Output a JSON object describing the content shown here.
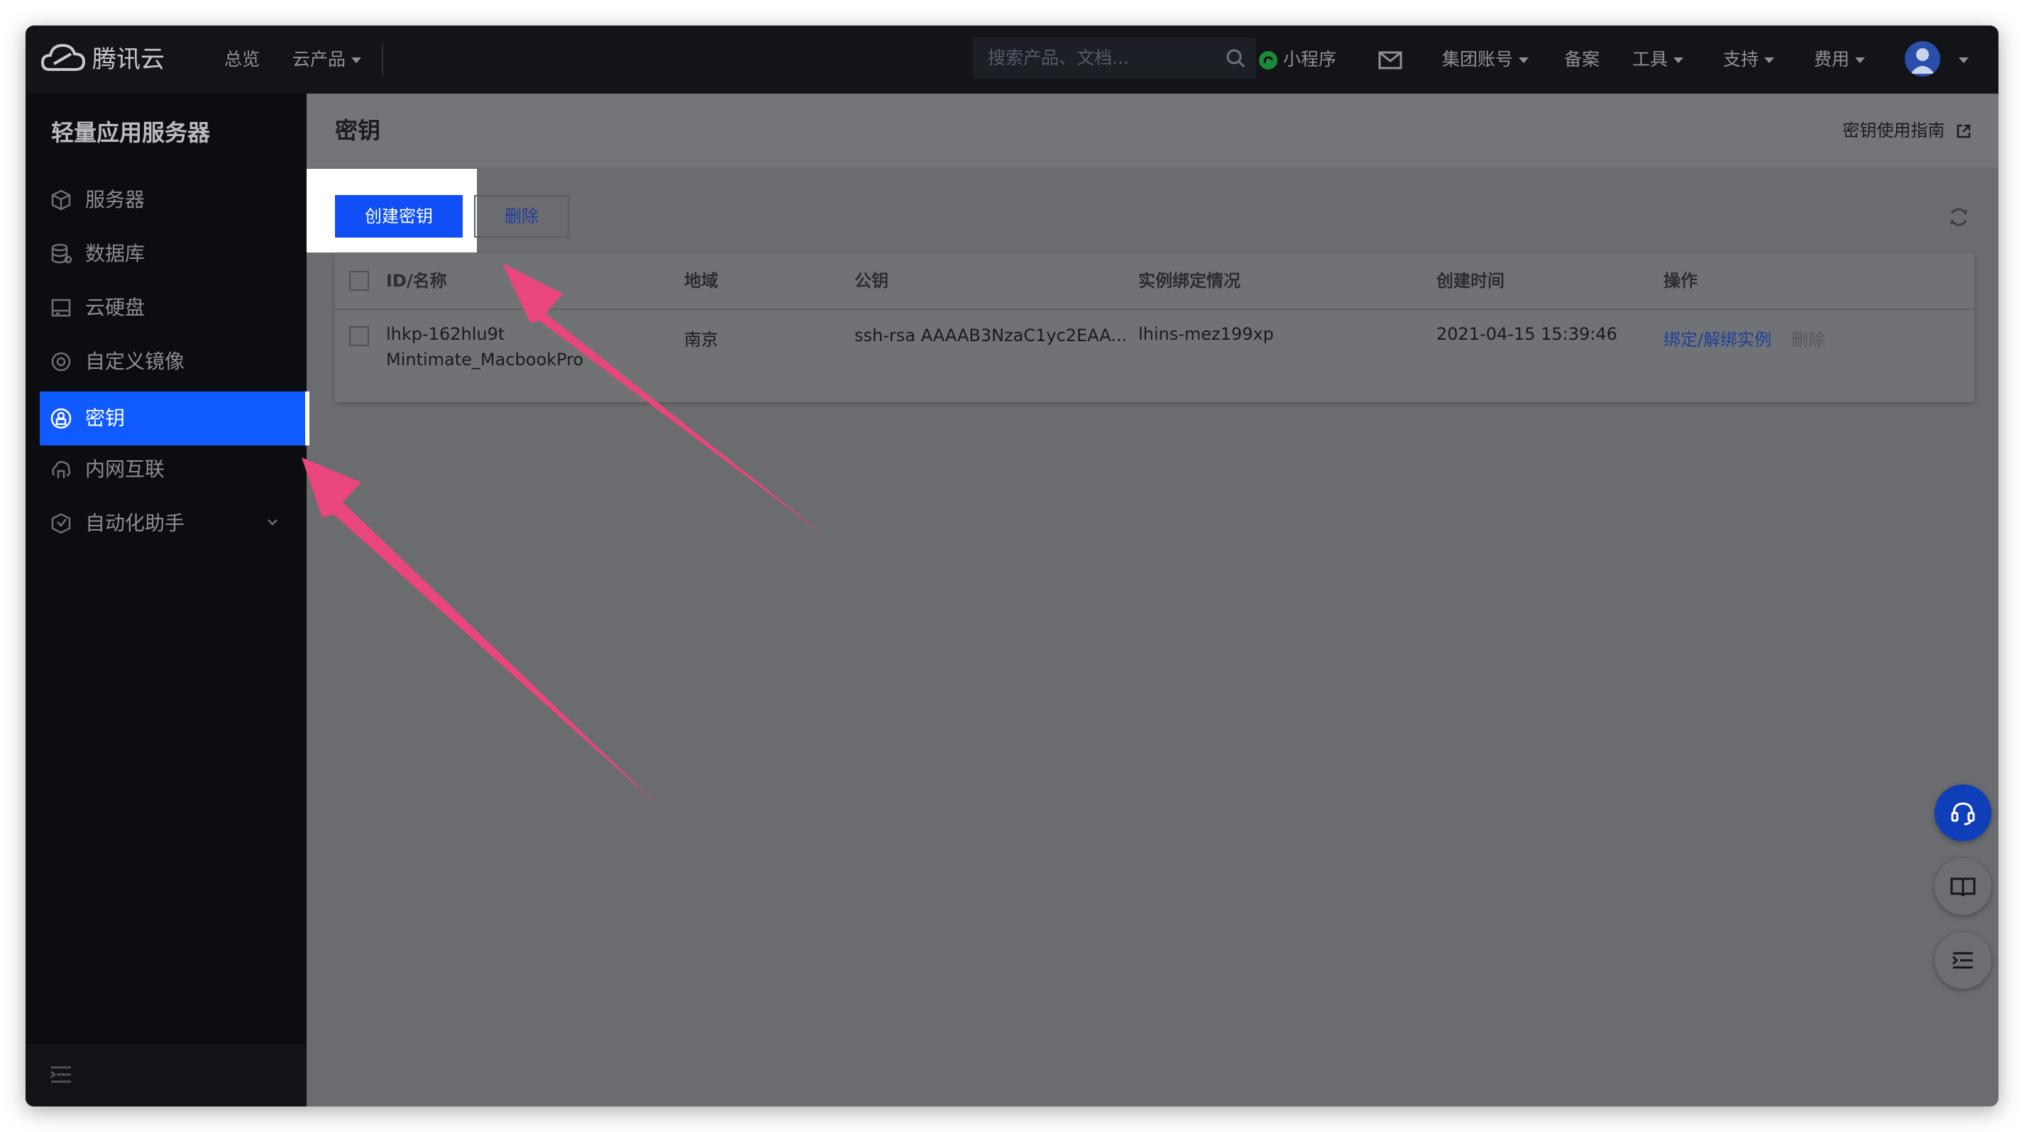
{
  "topbar": {
    "logo_text": "腾讯云",
    "nav_overview": "总览",
    "nav_products": "云产品",
    "search_placeholder": "搜索产品、文档...",
    "miniprogram": "小程序",
    "group_account": "集团账号",
    "beian": "备案",
    "tools": "工具",
    "support": "支持",
    "billing": "费用"
  },
  "sidebar": {
    "title": "轻量应用服务器",
    "items": [
      {
        "label": "服务器",
        "icon": "cube-icon"
      },
      {
        "label": "数据库",
        "icon": "database-icon"
      },
      {
        "label": "云硬盘",
        "icon": "disk-icon"
      },
      {
        "label": "自定义镜像",
        "icon": "image-icon"
      },
      {
        "label": "密钥",
        "icon": "key-icon",
        "active": true
      },
      {
        "label": "内网互联",
        "icon": "network-icon"
      },
      {
        "label": "自动化助手",
        "icon": "automation-icon"
      }
    ]
  },
  "page": {
    "title": "密钥",
    "guide_link": "密钥使用指南",
    "create_button": "创建密钥",
    "delete_button": "删除"
  },
  "table": {
    "columns": [
      "ID/名称",
      "地域",
      "公钥",
      "实例绑定情况",
      "创建时间",
      "操作"
    ],
    "rows": [
      {
        "id": "lhkp-162hlu9t",
        "name": "Mintimate_MacbookPro",
        "region": "南京",
        "public_key": "ssh-rsa AAAAB3NzaC1yc2EAA...",
        "bound_instance": "lhins-mez199xp",
        "created": "2021-04-15 15:39:46",
        "action_bind": "绑定/解绑实例",
        "action_delete": "删除"
      }
    ]
  },
  "colors": {
    "primary": "#0f4ff5",
    "annotation_arrow": "#e8467c",
    "sidebar_bg": "#0b0d11",
    "overlay_bg": "#6a6c70"
  }
}
